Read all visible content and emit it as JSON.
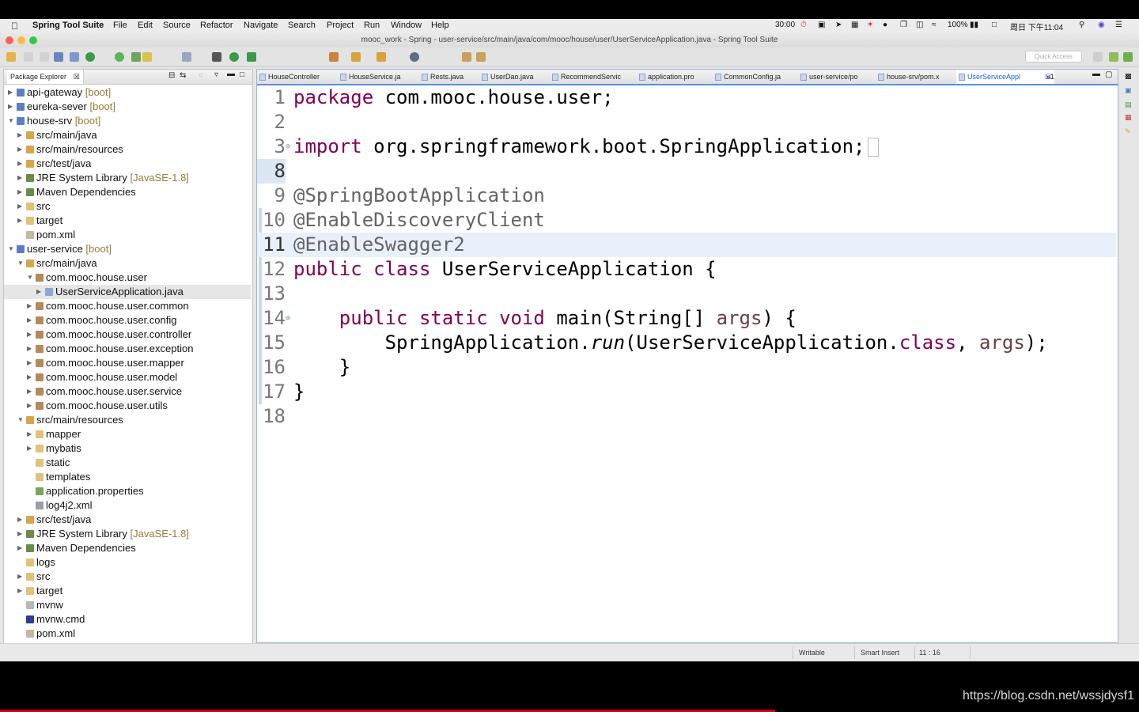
{
  "menubar": {
    "app": "Spring Tool Suite",
    "items": [
      "File",
      "Edit",
      "Source",
      "Refactor",
      "Navigate",
      "Search",
      "Project",
      "Run",
      "Window",
      "Help"
    ],
    "timer": "30:00",
    "battery": "100%",
    "clock": "周日 下午11:04"
  },
  "window": {
    "title": "mooc_work - Spring - user-service/src/main/java/com/mooc/house/user/UserServiceApplication.java - Spring Tool Suite"
  },
  "toolbar": {
    "quick_access_placeholder": "Quick Access"
  },
  "package_explorer": {
    "tab_label": "Package Explorer",
    "tree": [
      {
        "label": "api-gateway",
        "decor": "[boot]"
      },
      {
        "label": "eureka-sever",
        "decor": "[boot]"
      },
      {
        "label": "house-srv",
        "decor": "[boot]"
      },
      {
        "label": "src/main/java",
        "decor": ""
      },
      {
        "label": "src/main/resources",
        "decor": ""
      },
      {
        "label": "src/test/java",
        "decor": ""
      },
      {
        "label": "JRE System Library",
        "decor": "[JavaSE-1.8]"
      },
      {
        "label": "Maven Dependencies",
        "decor": ""
      },
      {
        "label": "src",
        "decor": ""
      },
      {
        "label": "target",
        "decor": ""
      },
      {
        "label": "pom.xml",
        "decor": ""
      },
      {
        "label": "user-service",
        "decor": "[boot]"
      },
      {
        "label": "src/main/java",
        "decor": ""
      },
      {
        "label": "com.mooc.house.user",
        "decor": ""
      },
      {
        "label": "UserServiceApplication.java",
        "decor": ""
      },
      {
        "label": "com.mooc.house.user.common",
        "decor": ""
      },
      {
        "label": "com.mooc.house.user.config",
        "decor": ""
      },
      {
        "label": "com.mooc.house.user.controller",
        "decor": ""
      },
      {
        "label": "com.mooc.house.user.exception",
        "decor": ""
      },
      {
        "label": "com.mooc.house.user.mapper",
        "decor": ""
      },
      {
        "label": "com.mooc.house.user.model",
        "decor": ""
      },
      {
        "label": "com.mooc.house.user.service",
        "decor": ""
      },
      {
        "label": "com.mooc.house.user.utils",
        "decor": ""
      },
      {
        "label": "src/main/resources",
        "decor": ""
      },
      {
        "label": "mapper",
        "decor": ""
      },
      {
        "label": "mybatis",
        "decor": ""
      },
      {
        "label": "static",
        "decor": ""
      },
      {
        "label": "templates",
        "decor": ""
      },
      {
        "label": "application.properties",
        "decor": ""
      },
      {
        "label": "log4j2.xml",
        "decor": ""
      },
      {
        "label": "src/test/java",
        "decor": ""
      },
      {
        "label": "JRE System Library",
        "decor": "[JavaSE-1.8]"
      },
      {
        "label": "Maven Dependencies",
        "decor": ""
      },
      {
        "label": "logs",
        "decor": ""
      },
      {
        "label": "src",
        "decor": ""
      },
      {
        "label": "target",
        "decor": ""
      },
      {
        "label": "mvnw",
        "decor": ""
      },
      {
        "label": "mvnw.cmd",
        "decor": ""
      },
      {
        "label": "pom.xml",
        "decor": ""
      }
    ]
  },
  "editor": {
    "tabs": [
      "HouseController",
      "HouseService.ja",
      "Rests.java",
      "UserDao.java",
      "RecommendServic",
      "application.pro",
      "CommonConfig.ja",
      "user-service/po",
      "house-srv/pom.x",
      "UserServiceAppl"
    ],
    "overflow_count": "»1",
    "active_tab": "UserServiceAppl",
    "lines": [
      {
        "n": "1",
        "kw": "package",
        "rest": " com.mooc.house.user;"
      },
      {
        "n": "2"
      },
      {
        "n": "3",
        "kw": "import",
        "rest": " org.springframework.boot.SpringApplication;"
      },
      {
        "n": "8"
      },
      {
        "n": "9",
        "ann": "@SpringBootApplication"
      },
      {
        "n": "10",
        "ann": "@EnableDiscoveryClient"
      },
      {
        "n": "11",
        "ann": "@EnableSwagger2"
      },
      {
        "n": "12",
        "kw": "public class",
        "rest": " UserServiceApplication {"
      },
      {
        "n": "13"
      },
      {
        "n": "14",
        "indent": "    ",
        "kw": "public static void",
        "rest": " main(String[] ",
        "var": "args",
        "tail": ") {"
      },
      {
        "n": "15",
        "prefix": "        SpringApplication.",
        "method": "run",
        "mid": "(UserServiceApplication.",
        "kw2": "class",
        "mid2": ", ",
        "var": "args",
        "tail": ");"
      },
      {
        "n": "16",
        "text": "    }"
      },
      {
        "n": "17",
        "text": "}"
      },
      {
        "n": "18"
      }
    ]
  },
  "status": {
    "writable": "Writable",
    "insert_mode": "Smart Insert",
    "position": "11 : 16"
  },
  "watermark": "https://blog.csdn.net/wssjdysf1"
}
